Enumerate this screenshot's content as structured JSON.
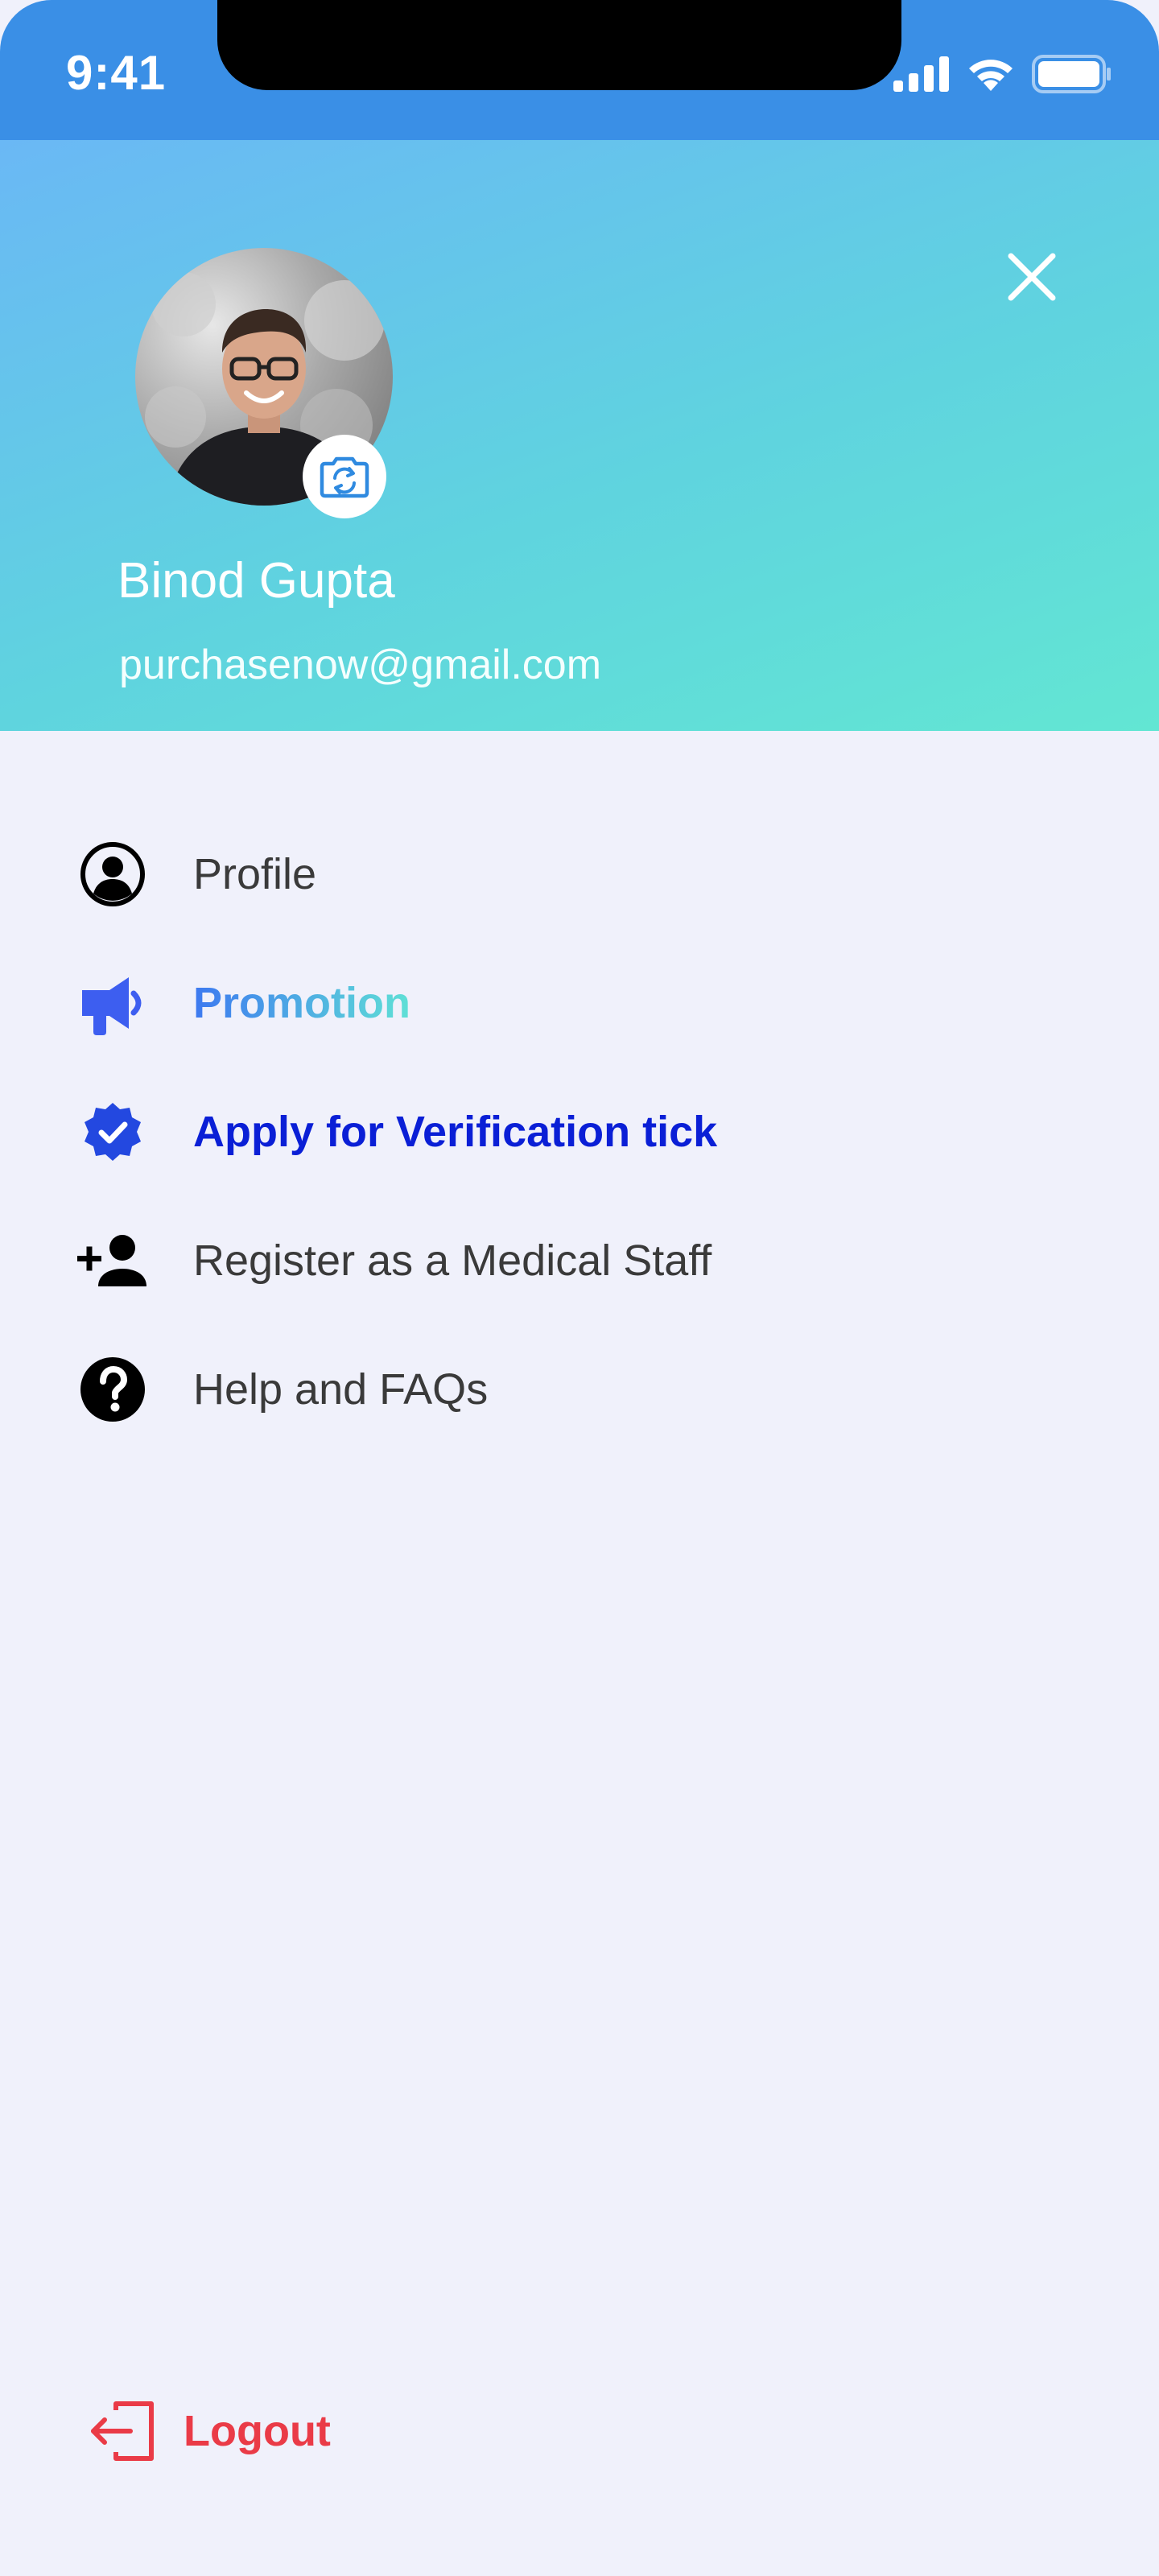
{
  "status_bar": {
    "time": "9:41"
  },
  "profile": {
    "name": "Binod Gupta",
    "email": "purchasenow@gmail.com"
  },
  "menu": {
    "items": [
      {
        "label": "Profile",
        "icon": "person-circle-icon"
      },
      {
        "label": "Promotion",
        "icon": "megaphone-icon"
      },
      {
        "label": "Apply for Verification tick",
        "icon": "verified-badge-icon"
      },
      {
        "label": "Register as a Medical Staff",
        "icon": "add-person-icon"
      },
      {
        "label": "Help and FAQs",
        "icon": "help-circle-icon"
      }
    ]
  },
  "logout": {
    "label": "Logout",
    "icon": "logout-icon"
  },
  "colors": {
    "status_bar": "#3a8fe6",
    "header_start": "#6ab8f5",
    "header_end": "#62e6d3",
    "background": "#f0f1fb",
    "verify_label": "#0a1fd6",
    "promotion_start": "#3d79f0",
    "promotion_end": "#5fe0d6",
    "logout": "#ea3b47"
  }
}
